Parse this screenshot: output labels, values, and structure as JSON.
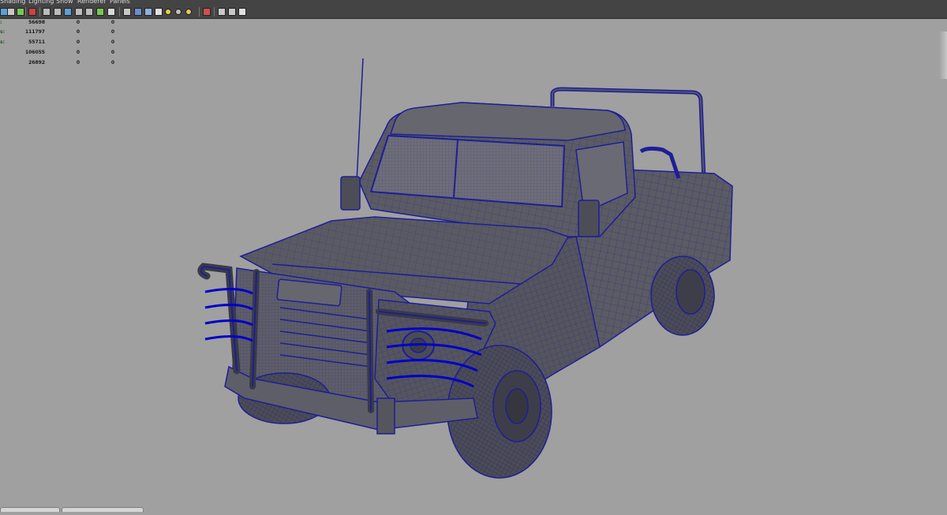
{
  "menu": {
    "items": [
      {
        "label": "Shading"
      },
      {
        "label": "Lighting"
      },
      {
        "label": "Show"
      },
      {
        "label": "Renderer"
      },
      {
        "label": "Panels"
      }
    ]
  },
  "toolbar": {
    "icons": [
      {
        "name": "camera-select-icon",
        "color": "#5aa0d8"
      },
      {
        "name": "camera-attributes-icon",
        "color": "#c8c8c8"
      },
      {
        "name": "bookmarks-icon",
        "color": "#78c850"
      },
      {
        "name": "image-plane-icon",
        "color": "#d04040"
      },
      {
        "name": "grid-icon",
        "color": "#bcbcbc"
      },
      {
        "name": "film-gate-icon",
        "color": "#bcbcbc"
      },
      {
        "name": "resolution-gate-icon",
        "color": "#5aa0d8"
      },
      {
        "name": "gate-mask-icon",
        "color": "#bcbcbc"
      },
      {
        "name": "field-chart-icon",
        "color": "#bcbcbc"
      },
      {
        "name": "safe-action-icon",
        "color": "#78c850"
      },
      {
        "name": "safe-title-icon",
        "color": "#d8d8d8"
      },
      {
        "name": "wireframe-icon",
        "color": "#c8c8c8"
      },
      {
        "name": "smooth-shade-icon",
        "color": "#6a8ed0"
      },
      {
        "name": "wireframe-on-shaded-icon",
        "color": "#8fb0e0"
      },
      {
        "name": "textured-icon",
        "color": "#e0e0e0"
      },
      {
        "name": "use-all-lights-icon",
        "color": "#f0d040"
      },
      {
        "name": "shadows-icon",
        "color": "#c0c0c0"
      },
      {
        "name": "ambient-occlusion-icon",
        "color": "#f0c060"
      },
      {
        "name": "isolate-select-icon",
        "color": "#d05050"
      },
      {
        "name": "xray-icon",
        "color": "#c8c8c8"
      },
      {
        "name": "xray-joints-icon",
        "color": "#c8c8c8"
      },
      {
        "name": "xray-components-icon",
        "color": "#e0e0e0"
      }
    ]
  },
  "hud": {
    "rows": [
      {
        "label": ":",
        "v1": "56698",
        "v2": "0",
        "v3": "0"
      },
      {
        "label": "s:",
        "v1": "111797",
        "v2": "0",
        "v3": "0"
      },
      {
        "label": "s:",
        "v1": "55711",
        "v2": "0",
        "v3": "0"
      },
      {
        "label": "",
        "v1": "106055",
        "v2": "0",
        "v3": "0"
      },
      {
        "label": "",
        "v1": "26892",
        "v2": "0",
        "v3": "0"
      }
    ]
  },
  "colors": {
    "viewport_background": "#a0a0a0",
    "model_fill": "#5b5b64",
    "wire_color": "#1e1e96",
    "highlight_wire": "#0000c8",
    "hud_label": "#1f5a1f",
    "menubar_background": "#444444"
  },
  "model": {
    "type": "pickup-truck-wireframe-on-shaded"
  }
}
